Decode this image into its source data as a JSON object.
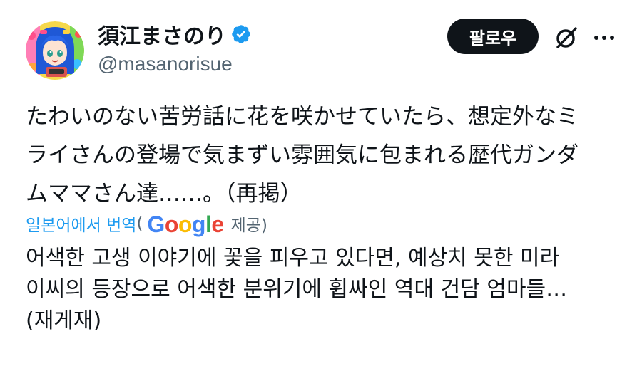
{
  "post": {
    "author": {
      "display_name": "須江まさのり",
      "handle": "@masanorisue",
      "verified_icon": "verified-badge-icon",
      "avatar": "avatar-anime-illustration"
    },
    "actions": {
      "follow_label": "팔로우",
      "grok_icon": "grok-slash-icon",
      "more_icon": "more-options-icon"
    },
    "original_text": "たわいのない苦労話に花を咲かせていたら、想定外なミ\nライさんの登場で気まずい雰囲気に包まれる歴代ガンダ\nムママさん達……。（再掲）",
    "translation": {
      "translated_from": "일본어에서 번역",
      "open_paren": "(",
      "provider": "Google",
      "provided_label": "제공)",
      "text": "어색한 고생 이야기에 꽃을 피우고 있다면, 예상치 못한 미라\n이씨의 등장으로 어색한 분위기에 휩싸인 역대 건담 엄마들…\n(재게재)"
    },
    "colors": {
      "accent": "#1d9bf0",
      "text_primary": "#0f1419",
      "text_secondary": "#536471",
      "button_bg": "#0f1419"
    }
  }
}
